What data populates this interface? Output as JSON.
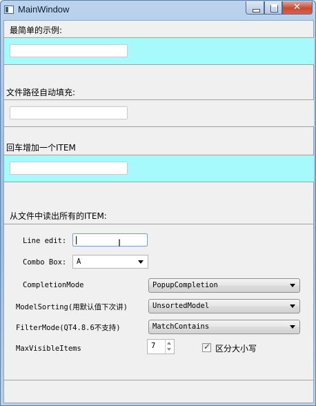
{
  "window": {
    "title": "MainWindow"
  },
  "section1": {
    "label": "最简单的示例:",
    "input_value": ""
  },
  "section2": {
    "label": "文件路径自动填充:",
    "input_value": ""
  },
  "section3": {
    "label": "回车增加一个ITEM",
    "input_value": ""
  },
  "section4": {
    "label": "从文件中读出所有的ITEM:",
    "line_edit_label": "Line edit:",
    "line_edit_value": "",
    "combo_box_label": "Combo Box:",
    "combo_box_value": "A",
    "completion_mode_label": "CompletionMode",
    "completion_mode_value": "PopupCompletion",
    "model_sorting_label": "ModelSorting(用默认值下次讲)",
    "model_sorting_value": "UnsortedModel",
    "filter_mode_label": "FilterMode(QT4.8.6不支持)",
    "filter_mode_value": "MatchContains",
    "max_visible_label": "MaxVisibleItems",
    "max_visible_value": "7",
    "case_sensitive_label": "区分大小写",
    "case_sensitive_checked": true
  }
}
